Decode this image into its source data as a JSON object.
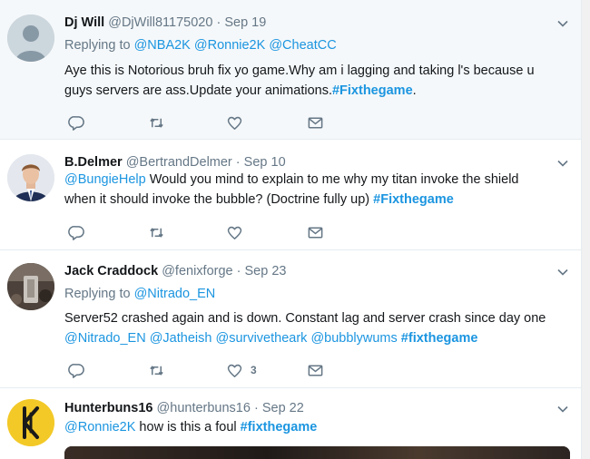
{
  "tweets": [
    {
      "name": "Dj Will",
      "handle": "@DjWill81175020",
      "dot": "·",
      "time": "Sep 19",
      "replying_label": "Replying to",
      "replying_to": [
        "@NBA2K",
        "@Ronnie2K",
        "@CheatCC"
      ],
      "text_line1": "Aye this is Notorious bruh fix yo game.Why am i lagging and taking l's because u",
      "text_line2_plain": "guys servers are ass.Update your animations.",
      "text_line2_hashtag": "#Fixthegame",
      "text_line2_end": ".",
      "likes": ""
    },
    {
      "name": "B.Delmer",
      "handle": "@BertrandDelmer",
      "dot": "·",
      "time": "Sep 10",
      "mention": "@BungieHelp",
      "text_line1_rest": " Would you mind to explain to me why my titan invoke the shield",
      "text_line2_plain": "when it should invoke the bubble? (Doctrine fully up) ",
      "hashtag": "#Fixthegame",
      "likes": ""
    },
    {
      "name": "Jack Craddock",
      "handle": "@fenixforge",
      "dot": "·",
      "time": "Sep 23",
      "replying_label": "Replying to",
      "replying_to": [
        "@Nitrado_EN"
      ],
      "text_line1": "Server52 crashed again and is down. Constant lag and server crash since day one",
      "mentions": [
        "@Nitrado_EN",
        "@Jatheish",
        "@survivetheark",
        "@bubblywums"
      ],
      "hashtag": "#fixthegame",
      "likes": "3"
    },
    {
      "name": "Hunterbuns16",
      "handle": "@hunterbuns16",
      "dot": "·",
      "time": "Sep 22",
      "mention": "@Ronnie2K",
      "text_rest": " how is this a foul ",
      "hashtag": "#fixthegame"
    }
  ],
  "colors": {
    "link": "#1b95e0",
    "secondary": "#657786",
    "highlight_bg": "#f5f8fa",
    "logo_yellow": "#f3c928"
  },
  "icons": [
    "reply-icon",
    "retweet-icon",
    "like-icon",
    "direct-message-icon",
    "chevron-down-icon"
  ]
}
